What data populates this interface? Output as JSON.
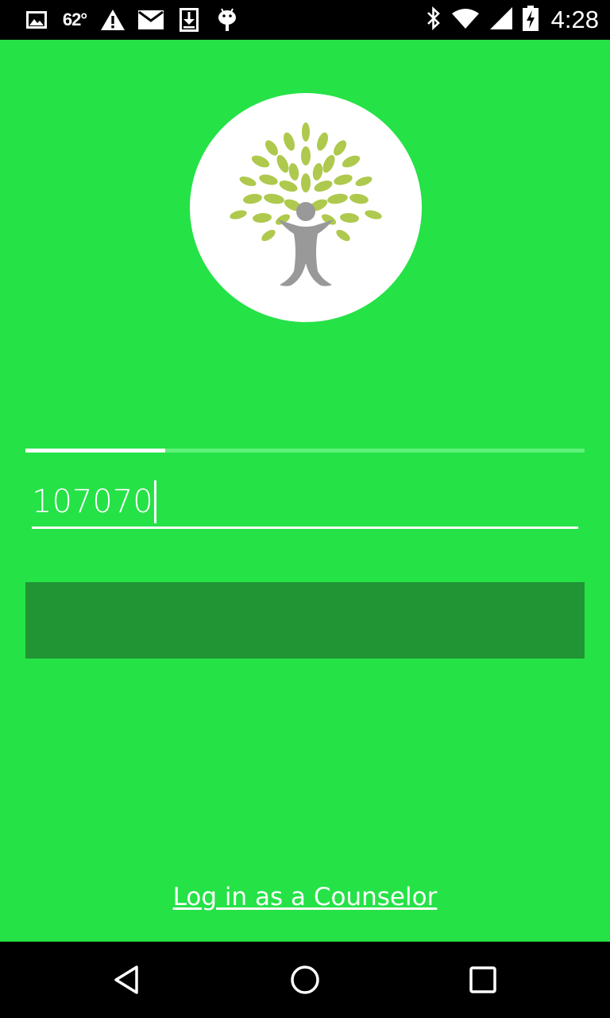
{
  "status_bar": {
    "left_icons": [
      "image-icon",
      "temperature",
      "warning-icon",
      "mail-icon",
      "download-icon",
      "android-icon"
    ],
    "temperature": "62°",
    "right_icons": [
      "bluetooth-icon",
      "wifi-icon",
      "signal-icon",
      "battery-charging-icon"
    ],
    "time": "4:28"
  },
  "colors": {
    "background": "#25e247",
    "button": "#219434",
    "status_bar": "#000000",
    "leaf": "#aec94d",
    "figure": "#999999"
  },
  "logo": {
    "icon": "tree-person-logo"
  },
  "progress": {
    "value": 0.25
  },
  "login_form": {
    "code_value": "107070",
    "submit_label": ""
  },
  "footer": {
    "counselor_link": "Log in as a Counselor"
  },
  "nav_bar": {
    "icons": [
      "back-icon",
      "home-icon",
      "recents-icon"
    ]
  }
}
